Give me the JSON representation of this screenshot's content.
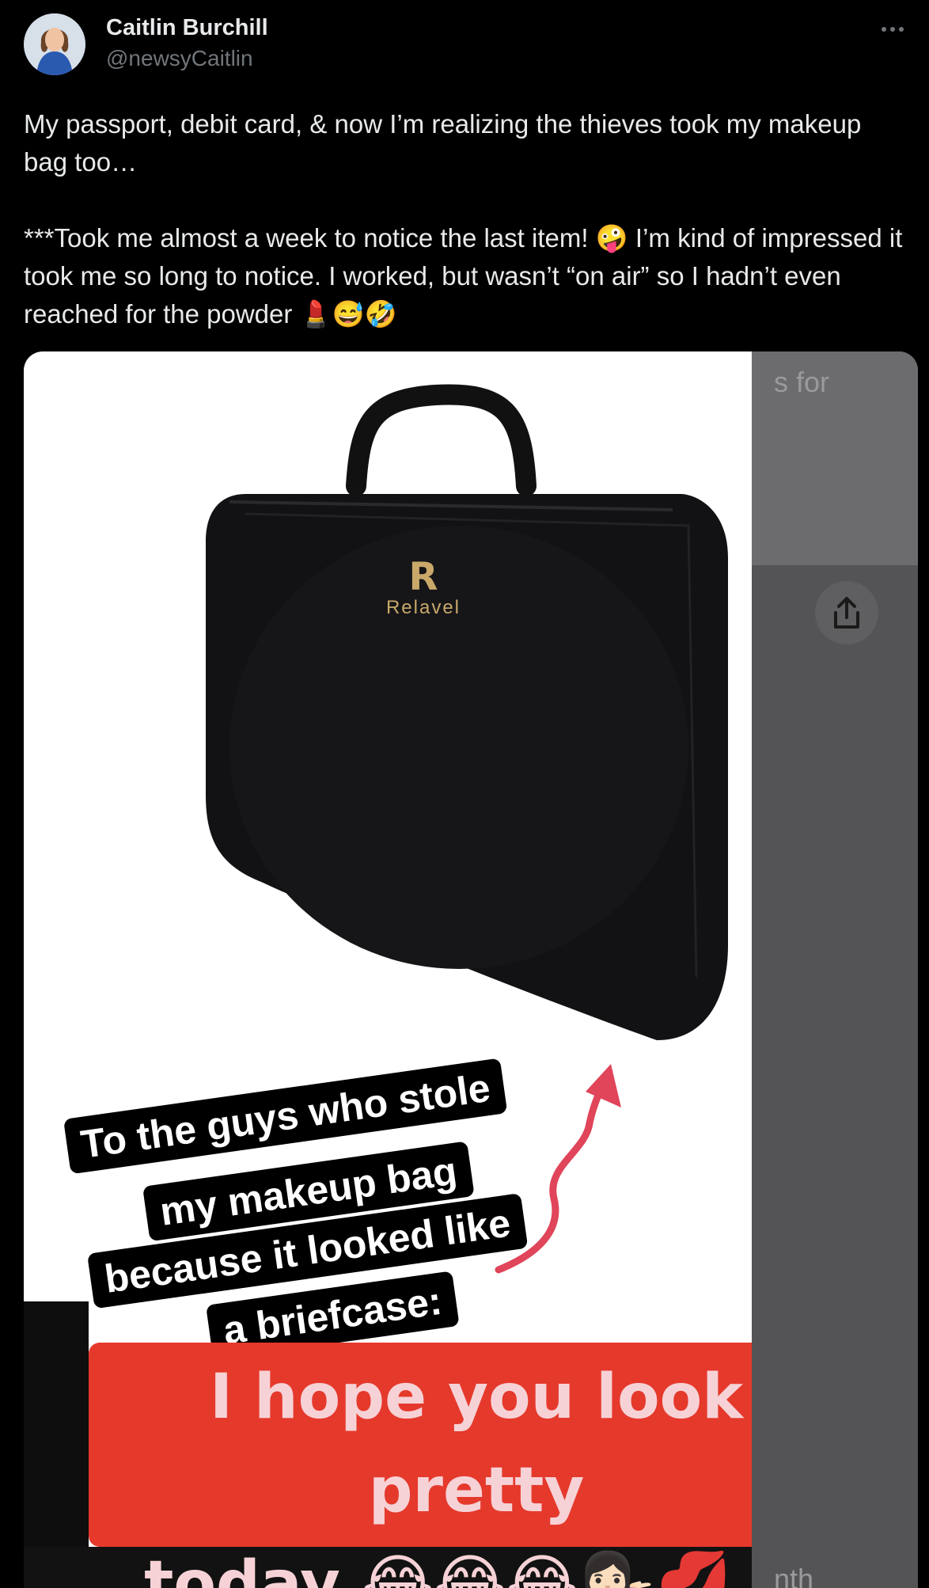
{
  "author": {
    "name": "Caitlin Burchill",
    "handle": "@newsyCaitlin"
  },
  "tweet": {
    "text": "My passport, debit card, & now I’m realizing the thieves took my makeup bag too…\n\n***Took me almost a week to notice the last item! 🤪 I’m kind of impressed it took me so long to notice. I worked, but wasn’t “on air” so I hadn’t even reached for the powder 💄😅🤣"
  },
  "media": {
    "brand_logo_text": "Relavel",
    "caption_lines": [
      "To the guys who stole",
      "my makeup bag",
      "because it looked like",
      "a briefcase:"
    ],
    "banner_line1": "I hope you look pretty",
    "banner_line2": "today 😂😂😂💁🏻‍♀️💋💄",
    "side_text_top": "s for",
    "side_text_bottom": "nth"
  },
  "icons": {
    "more": "more-horizontal-icon",
    "share": "share-icon"
  },
  "colors": {
    "background": "#000000",
    "text_primary": "#e7e9ea",
    "text_secondary": "#71767b",
    "banner": "#e5392c"
  }
}
